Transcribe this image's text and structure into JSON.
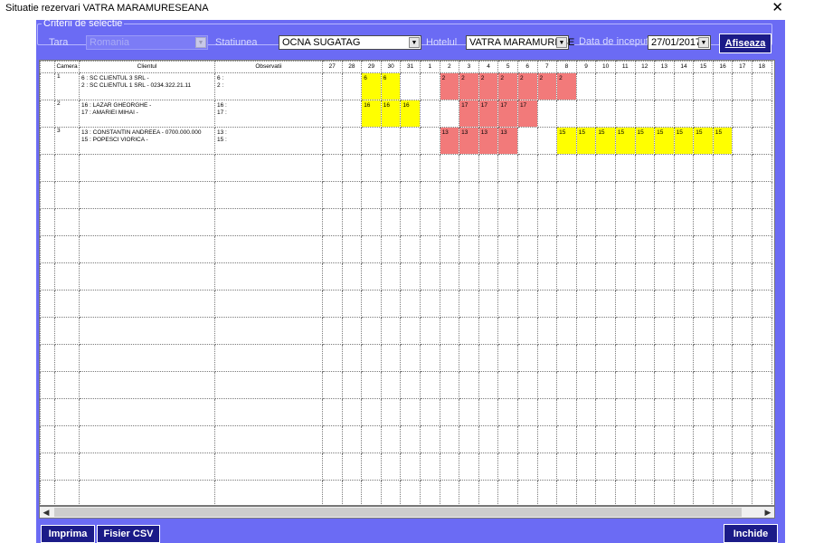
{
  "window": {
    "title": "Situatie rezervari VATRA MARAMURESEANA",
    "close_icon": "close-icon"
  },
  "criteria": {
    "legend": "Criterii de selectie",
    "tara_label": "Tara",
    "tara_value": "Romania",
    "statiunea_label": "Statiunea",
    "statiunea_value": "OCNA SUGATAG",
    "hotelul_label": "Hotelul",
    "hotelul_value": "VATRA MARAMURESE",
    "data_label": "Data de inceput",
    "data_value": "27/01/2017",
    "afiseaza_label": "Afiseaza"
  },
  "grid": {
    "headers": {
      "camera": "Camera",
      "clientul": "Clientul",
      "observatii": "Observatii"
    },
    "days": [
      "27",
      "28",
      "29",
      "30",
      "31",
      "1",
      "2",
      "3",
      "4",
      "5",
      "6",
      "7",
      "8",
      "9",
      "10",
      "11",
      "12",
      "13",
      "14",
      "15",
      "16",
      "17",
      "18"
    ],
    "rows": [
      {
        "camera": "1",
        "clientul": [
          "6 : SC CLIENTUL 3 SRL -",
          "2 : SC CLIENTUL 1 SRL - 0234.322.21.11"
        ],
        "observatii": [
          "6 :",
          "2 :"
        ],
        "days": [
          null,
          null,
          {
            "t": "6",
            "c": "y"
          },
          {
            "t": "6",
            "c": "y"
          },
          null,
          null,
          {
            "t": "2",
            "c": "r"
          },
          {
            "t": "2",
            "c": "r"
          },
          {
            "t": "2",
            "c": "r"
          },
          {
            "t": "2",
            "c": "r"
          },
          {
            "t": "2",
            "c": "r"
          },
          {
            "t": "2",
            "c": "r"
          },
          {
            "t": "2",
            "c": "r"
          },
          null,
          null,
          null,
          null,
          null,
          null,
          null,
          null,
          null,
          null
        ]
      },
      {
        "camera": "2",
        "clientul": [
          "16 : LAZAR GHEORGHE -",
          "17 : AMARIEI MIHAI -"
        ],
        "observatii": [
          "16 :",
          "17 :"
        ],
        "days": [
          null,
          null,
          {
            "t": "16",
            "c": "y"
          },
          {
            "t": "16",
            "c": "y"
          },
          {
            "t": "16",
            "c": "y"
          },
          null,
          null,
          {
            "t": "17",
            "c": "r"
          },
          {
            "t": "17",
            "c": "r"
          },
          {
            "t": "17",
            "c": "r"
          },
          {
            "t": "17",
            "c": "r"
          },
          null,
          null,
          null,
          null,
          null,
          null,
          null,
          null,
          null,
          null,
          null,
          null
        ]
      },
      {
        "camera": "3",
        "clientul": [
          "13 : CONSTANTIN ANDREEA - 0700.000.000",
          "15 : POPESCI VIORICA -"
        ],
        "observatii": [
          "13 :",
          "15 :"
        ],
        "days": [
          null,
          null,
          null,
          null,
          null,
          null,
          {
            "t": "13",
            "c": "r"
          },
          {
            "t": "13",
            "c": "r"
          },
          {
            "t": "13",
            "c": "r"
          },
          {
            "t": "13",
            "c": "r"
          },
          null,
          null,
          {
            "t": "15",
            "c": "y"
          },
          {
            "t": "15",
            "c": "y"
          },
          {
            "t": "15",
            "c": "y"
          },
          {
            "t": "15",
            "c": "y"
          },
          {
            "t": "15",
            "c": "y"
          },
          {
            "t": "15",
            "c": "y"
          },
          {
            "t": "15",
            "c": "y"
          },
          {
            "t": "15",
            "c": "y"
          },
          {
            "t": "15",
            "c": "y"
          },
          null,
          null
        ]
      }
    ]
  },
  "footer": {
    "imprima_label": "Imprima",
    "csv_label": "Fisier CSV",
    "inchide_label": "Inchide"
  },
  "colors": {
    "panel": "#6b6bf4",
    "button": "#1b1b88",
    "yellow": "#ffff00",
    "red": "#f27a7a"
  }
}
